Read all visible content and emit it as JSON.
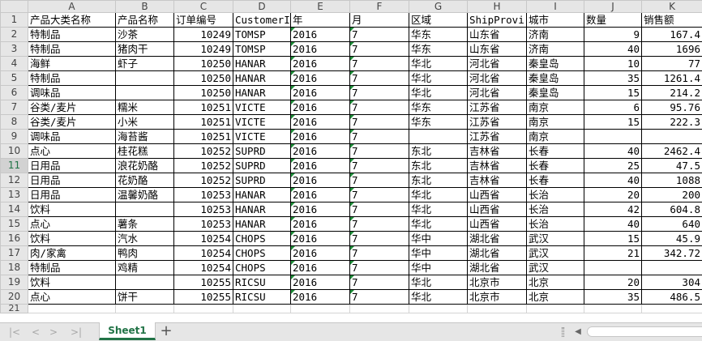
{
  "columns": [
    "A",
    "B",
    "C",
    "D",
    "E",
    "F",
    "G",
    "H",
    "I",
    "J",
    "K"
  ],
  "row_numbers": [
    "1",
    "2",
    "3",
    "4",
    "5",
    "6",
    "7",
    "8",
    "9",
    "10",
    "11",
    "12",
    "13",
    "14",
    "15",
    "16",
    "17",
    "18",
    "19",
    "20",
    "21"
  ],
  "selected_row": "11",
  "rows": [
    [
      "产品大类名称",
      "产品名称",
      "订单编号",
      "CustomerI",
      "年",
      "月",
      "区域",
      "ShipProvi",
      "城市",
      "数量",
      "销售额"
    ],
    [
      "特制品",
      "沙茶",
      "10249",
      "TOMSP",
      "2016",
      "7",
      "华东",
      "山东省",
      "济南",
      "9",
      "167.4"
    ],
    [
      "特制品",
      "猪肉干",
      "10249",
      "TOMSP",
      "2016",
      "7",
      "华东",
      "山东省",
      "济南",
      "40",
      "1696"
    ],
    [
      "海鲜",
      "虾子",
      "10250",
      "HANAR",
      "2016",
      "7",
      "华北",
      "河北省",
      "秦皇岛",
      "10",
      "77"
    ],
    [
      "特制品",
      "",
      "10250",
      "HANAR",
      "2016",
      "7",
      "华北",
      "河北省",
      "秦皇岛",
      "35",
      "1261.4"
    ],
    [
      "调味品",
      "",
      "10250",
      "HANAR",
      "2016",
      "7",
      "华北",
      "河北省",
      "秦皇岛",
      "15",
      "214.2"
    ],
    [
      "谷类/麦片",
      "糯米",
      "10251",
      "VICTE",
      "2016",
      "7",
      "华东",
      "江苏省",
      "南京",
      "6",
      "95.76"
    ],
    [
      "谷类/麦片",
      "小米",
      "10251",
      "VICTE",
      "2016",
      "7",
      "华东",
      "江苏省",
      "南京",
      "15",
      "222.3"
    ],
    [
      "调味品",
      "海苔酱",
      "10251",
      "VICTE",
      "2016",
      "7",
      "",
      "江苏省",
      "南京",
      "",
      ""
    ],
    [
      "点心",
      "桂花糕",
      "10252",
      "SUPRD",
      "2016",
      "7",
      "东北",
      "吉林省",
      "长春",
      "40",
      "2462.4"
    ],
    [
      "日用品",
      "浪花奶酪",
      "10252",
      "SUPRD",
      "2016",
      "7",
      "东北",
      "吉林省",
      "长春",
      "25",
      "47.5"
    ],
    [
      "日用品",
      "花奶酪",
      "10252",
      "SUPRD",
      "2016",
      "7",
      "东北",
      "吉林省",
      "长春",
      "40",
      "1088"
    ],
    [
      "日用品",
      "温馨奶酪",
      "10253",
      "HANAR",
      "2016",
      "7",
      "华北",
      "山西省",
      "长治",
      "20",
      "200"
    ],
    [
      "饮料",
      "",
      "10253",
      "HANAR",
      "2016",
      "7",
      "华北",
      "山西省",
      "长治",
      "42",
      "604.8"
    ],
    [
      "点心",
      "薯条",
      "10253",
      "HANAR",
      "2016",
      "7",
      "华北",
      "山西省",
      "长治",
      "40",
      "640"
    ],
    [
      "饮料",
      "汽水",
      "10254",
      "CHOPS",
      "2016",
      "7",
      "华中",
      "湖北省",
      "武汉",
      "15",
      "45.9"
    ],
    [
      "肉/家禽",
      "鸭肉",
      "10254",
      "CHOPS",
      "2016",
      "7",
      "华中",
      "湖北省",
      "武汉",
      "21",
      "342.72"
    ],
    [
      "特制品",
      "鸡精",
      "10254",
      "CHOPS",
      "2016",
      "7",
      "华中",
      "湖北省",
      "武汉",
      "",
      ""
    ],
    [
      "饮料",
      "",
      "10255",
      "RICSU",
      "2016",
      "7",
      "华北",
      "北京市",
      "北京",
      "20",
      "304"
    ],
    [
      "点心",
      "饼干",
      "10255",
      "RICSU",
      "2016",
      "7",
      "华北",
      "北京市",
      "北京",
      "35",
      "486.5"
    ]
  ],
  "sheet_tab": "Sheet1",
  "add_sheet_label": "+",
  "nav": {
    "first": "|<",
    "prev": "<",
    "next": ">",
    "last": ">|",
    "scroll_left": "◀"
  },
  "accent_color": "#217346"
}
